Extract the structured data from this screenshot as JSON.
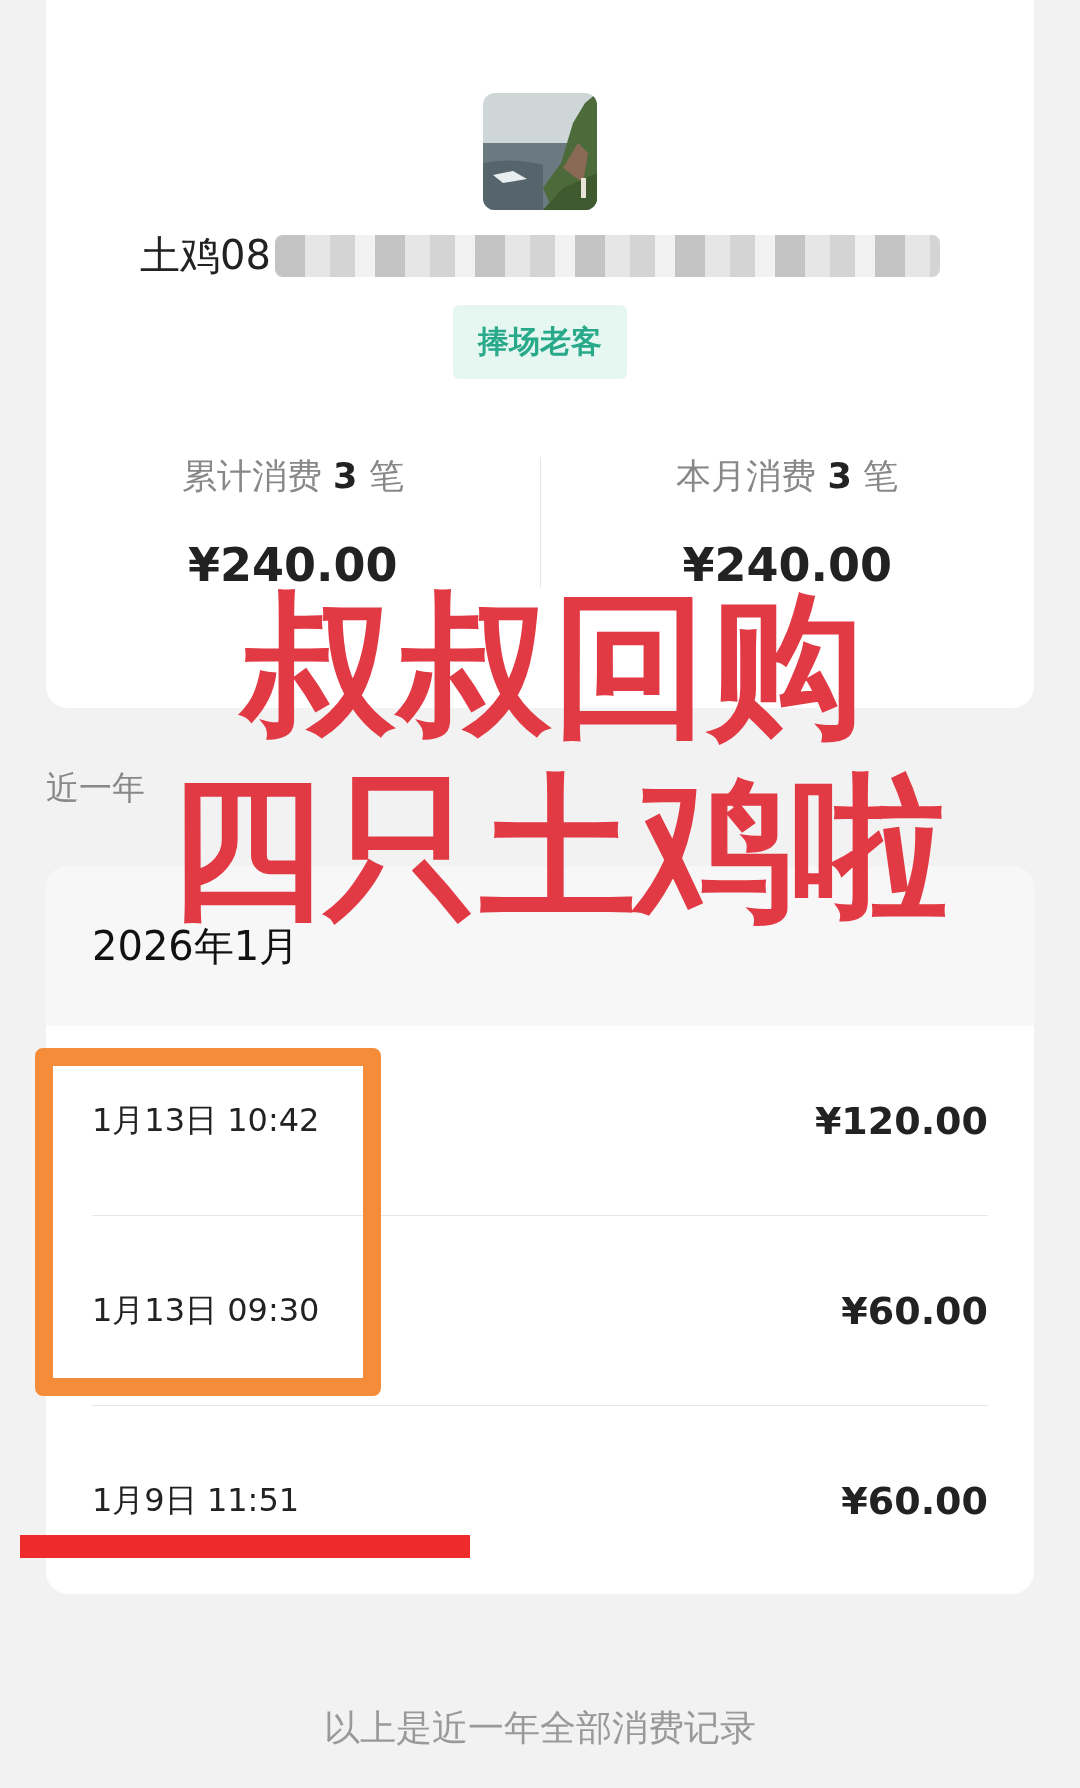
{
  "profile": {
    "name": "土鸡08",
    "name_blurred": true,
    "tag": "捧场老客"
  },
  "stats": [
    {
      "label": "累计消费 **3** 笔",
      "amount": "¥240.00"
    },
    {
      "label": "本月消费 **3** 笔",
      "amount": "¥240.00"
    }
  ],
  "records": {
    "title": "近一年",
    "month": "2026年1月",
    "rows": [
      {
        "time": "1月13日 10:42",
        "amount": "¥120.00"
      },
      {
        "time": "1月13日 09:30",
        "amount": "¥60.00"
      },
      {
        "time": "1月9日 11:51",
        "amount": "¥60.00"
      }
    ]
  },
  "footer": "以上是近一年全部消费记录",
  "overlay": {
    "caption_lines": [
      "叔叔回购",
      "四只土鸡啦"
    ],
    "highlight_box": true,
    "underline": true
  }
}
